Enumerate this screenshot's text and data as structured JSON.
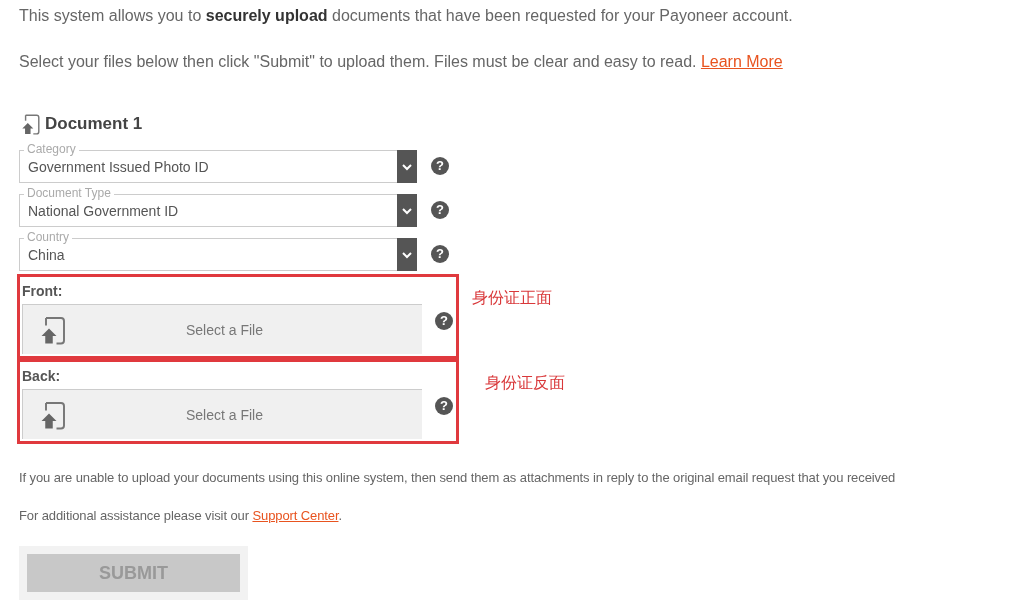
{
  "intro": [
    {
      "text": "This system allows you to **securely upload** documents that have been requested for your Payoneer account."
    },
    {
      "text": "Select your files below then click \"Submit\" to upload them. Files must be clear and easy to read.",
      "link": "Learn More"
    }
  ],
  "document": {
    "title": "Document 1",
    "selects": [
      {
        "label": "Category",
        "value": "Government Issued Photo ID",
        "help": "?"
      },
      {
        "label": "Document Type",
        "value": "National Government ID",
        "help": "?"
      },
      {
        "label": "Country",
        "value": "China",
        "help": "?"
      }
    ],
    "files": [
      {
        "label": "Front:",
        "button": "Select a File",
        "help": "?",
        "highlighted": true,
        "annotation": "身份证正面"
      },
      {
        "label": "Back:",
        "button": "Select a File",
        "help": "?",
        "highlighted": true,
        "annotation": "身份证反面"
      }
    ]
  },
  "footer": [
    {
      "text": "If you are unable to upload your documents using this online system, then send them as attachments in reply to the original email request that you received"
    },
    {
      "text": "For additional assistance please visit our",
      "link": "Support Center",
      "after": "."
    }
  ],
  "submit": {
    "label": "SUBMIT",
    "disabled": true
  }
}
